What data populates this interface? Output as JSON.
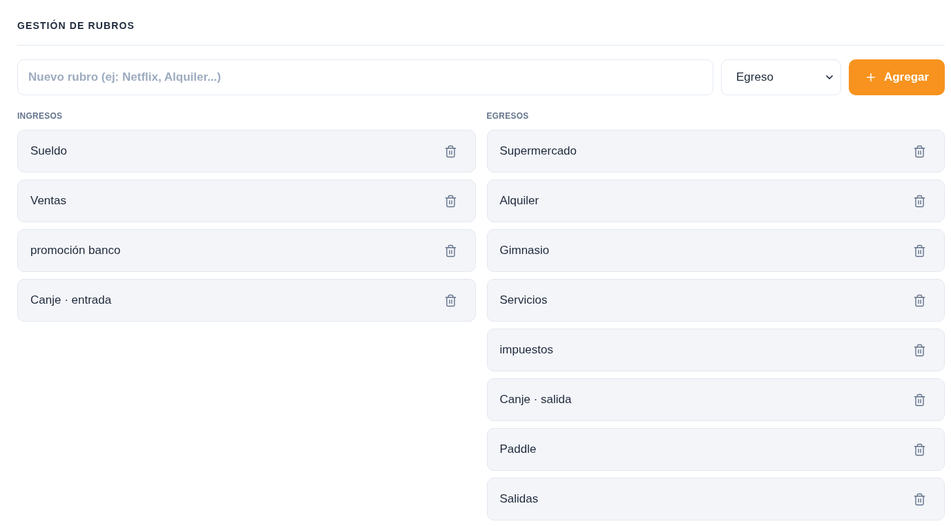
{
  "page": {
    "title": "GESTIÓN DE RUBROS"
  },
  "add_form": {
    "name_field": {
      "placeholder": "Nuevo rubro (ej: Netflix, Alquiler...)"
    },
    "type_select": {
      "value": "Egreso"
    },
    "add_button": {
      "label": "Agregar"
    }
  },
  "columns": [
    {
      "heading": "INGRESOS",
      "items": [
        {
          "name": "Sueldo"
        },
        {
          "name": "Ventas"
        },
        {
          "name": "promoción banco"
        },
        {
          "name": "Canje · entrada"
        }
      ]
    },
    {
      "heading": "EGRESOS",
      "items": [
        {
          "name": "Supermercado"
        },
        {
          "name": "Alquiler"
        },
        {
          "name": "Gimnasio"
        },
        {
          "name": "Servicios"
        },
        {
          "name": "impuestos"
        },
        {
          "name": "Canje · salida"
        },
        {
          "name": "Paddle"
        },
        {
          "name": "Salidas"
        }
      ]
    }
  ]
}
